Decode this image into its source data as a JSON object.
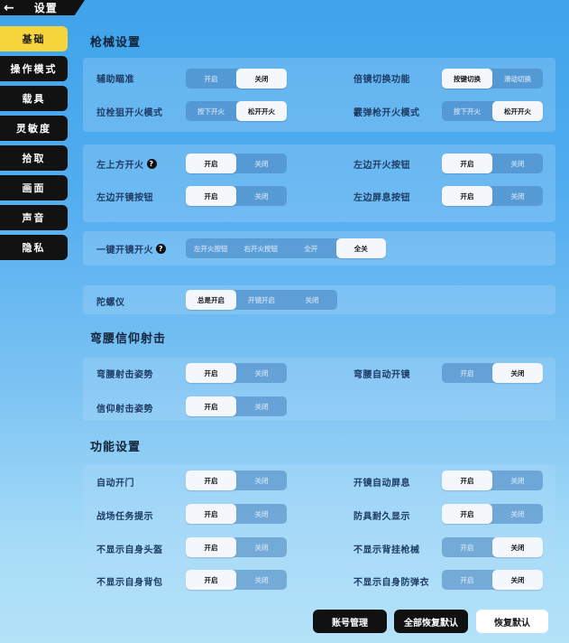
{
  "header": {
    "title": "设置",
    "back_icon": "arrow-left"
  },
  "sidebar": {
    "items": [
      {
        "label": "基础",
        "active": true
      },
      {
        "label": "操作模式",
        "active": false
      },
      {
        "label": "载具",
        "active": false
      },
      {
        "label": "灵敏度",
        "active": false
      },
      {
        "label": "拾取",
        "active": false
      },
      {
        "label": "画面",
        "active": false
      },
      {
        "label": "声音",
        "active": false
      },
      {
        "label": "隐私",
        "active": false
      }
    ]
  },
  "sections": {
    "gun": {
      "title": "枪械设置"
    },
    "crouch": {
      "title": "弯腰信仰射击"
    },
    "function": {
      "title": "功能设置"
    }
  },
  "settings": {
    "aim_assist": {
      "label": "辅助瞄准",
      "options": [
        "开启",
        "关闭"
      ],
      "selected": 1
    },
    "scope_switch": {
      "label": "倍镜切换功能",
      "options": [
        "按键切换",
        "滑动切换"
      ],
      "selected": 0
    },
    "bolt_fire_mode": {
      "label": "拉栓狙开火模式",
      "options": [
        "按下开火",
        "松开开火"
      ],
      "selected": 1
    },
    "shotgun_fire_mode": {
      "label": "霰弹枪开火模式",
      "options": [
        "按下开火",
        "松开开火"
      ],
      "selected": 1
    },
    "top_left_fire": {
      "label": "左上方开火",
      "help": true,
      "options": [
        "开启",
        "关闭"
      ],
      "selected": 0
    },
    "left_fire_button": {
      "label": "左边开火按钮",
      "options": [
        "开启",
        "关闭"
      ],
      "selected": 0
    },
    "left_scope_button": {
      "label": "左边开镜按钮",
      "options": [
        "开启",
        "关闭"
      ],
      "selected": 0
    },
    "left_breath_button": {
      "label": "左边屏息按钮",
      "options": [
        "开启",
        "关闭"
      ],
      "selected": 0
    },
    "one_key_scope_fire": {
      "label": "一键开镜开火",
      "help": true,
      "options": [
        "左开火按钮",
        "右开火按钮",
        "全开",
        "全关"
      ],
      "selected": 3
    },
    "gyroscope": {
      "label": "陀螺仪",
      "options": [
        "总是开启",
        "开镜开启",
        "关闭"
      ],
      "selected": 0
    },
    "crouch_shoot": {
      "label": "弯腰射击姿势",
      "options": [
        "开启",
        "关闭"
      ],
      "selected": 0
    },
    "crouch_auto_scope": {
      "label": "弯腰自动开镜",
      "options": [
        "开启",
        "关闭"
      ],
      "selected": 1
    },
    "faith_shoot": {
      "label": "信仰射击姿势",
      "options": [
        "开启",
        "关闭"
      ],
      "selected": 0
    },
    "auto_door": {
      "label": "自动开门",
      "options": [
        "开启",
        "关闭"
      ],
      "selected": 0
    },
    "scope_auto_breath": {
      "label": "开镜自动屏息",
      "options": [
        "开启",
        "关闭"
      ],
      "selected": 0
    },
    "mission_hint": {
      "label": "战场任务提示",
      "options": [
        "开启",
        "关闭"
      ],
      "selected": 0
    },
    "armor_durability": {
      "label": "防具耐久显示",
      "options": [
        "开启",
        "关闭"
      ],
      "selected": 0
    },
    "hide_helmet": {
      "label": "不显示自身头盔",
      "options": [
        "开启",
        "关闭"
      ],
      "selected": 0
    },
    "hide_back_gun": {
      "label": "不显示背挂枪械",
      "options": [
        "开启",
        "关闭"
      ],
      "selected": 1
    },
    "hide_backpack": {
      "label": "不显示自身背包",
      "options": [
        "开启",
        "关闭"
      ],
      "selected": 0
    },
    "hide_vest": {
      "label": "不显示自身防弹衣",
      "options": [
        "开启",
        "关闭"
      ],
      "selected": 1
    }
  },
  "footer": {
    "account": "账号管理",
    "reset_all": "全部恢复默认",
    "reset": "恢复默认"
  }
}
